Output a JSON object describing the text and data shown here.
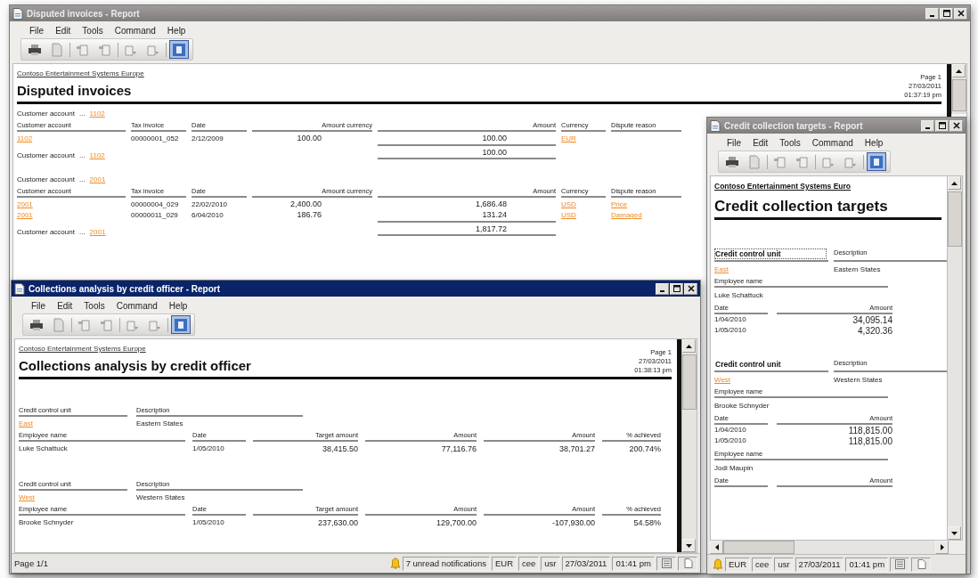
{
  "windows": [
    {
      "kind": "disputed",
      "title": "Disputed invoices - Report",
      "active": false,
      "menu": [
        "File",
        "Edit",
        "Tools",
        "Command",
        "Help"
      ],
      "toolbar": [
        {
          "kind": "print",
          "selected": false
        },
        {
          "kind": "copy",
          "selected": false
        },
        {
          "kind": "up",
          "selected": false
        },
        {
          "kind": "down",
          "selected": false
        },
        {
          "kind": "prev",
          "selected": false
        },
        {
          "kind": "next",
          "selected": false
        },
        {
          "kind": "fit",
          "selected": true
        }
      ],
      "company": "Contoso Entertainment Systems Europe",
      "heading": "Disputed invoices",
      "page": "Page 1",
      "date": "27/03/2011",
      "time": "01:37:19 pm",
      "groups": [
        {
          "label": "Customer account",
          "leader": "...",
          "account": "1102",
          "columns": [
            "Customer account",
            "Tax invoice",
            "Date",
            "Amount currency",
            "Amount",
            "Currency",
            "Dispute reason"
          ],
          "rows": [
            {
              "account": "1102",
              "tax_invoice": "00000001_052",
              "date": "2/12/2009",
              "amount_currency": "100.00",
              "amount": "100.00",
              "currency": "EUR"
            }
          ],
          "footer_label": "Customer account",
          "footer_leader": "...",
          "footer_account": "1102",
          "total": "100.00"
        },
        {
          "label": "Customer account",
          "leader": "...",
          "account": "2001",
          "columns": [
            "Customer account",
            "Tax invoice",
            "Date",
            "Amount currency",
            "Amount",
            "Currency",
            "Dispute reason"
          ],
          "rows": [
            {
              "account": "2001",
              "tax_invoice": "00000004_029",
              "date": "22/02/2010",
              "amount_currency": "2,400.00",
              "amount": "1,686.48",
              "currency": "USD",
              "dispute_reason": "Price"
            },
            {
              "account": "2001",
              "tax_invoice": "00000011_029",
              "date": "6/04/2010",
              "amount_currency": "186.76",
              "amount": "131.24",
              "currency": "USD",
              "dispute_reason": "Damaged"
            }
          ],
          "footer_label": "Customer account",
          "footer_leader": "...",
          "footer_account": "2001",
          "total": "1,817.72"
        }
      ]
    },
    {
      "kind": "collections",
      "title": "Collections analysis by credit officer - Report",
      "active": true,
      "menu": [
        "File",
        "Edit",
        "Tools",
        "Command",
        "Help"
      ],
      "toolbar": [
        {
          "kind": "print",
          "selected": false
        },
        {
          "kind": "copy",
          "selected": false
        },
        {
          "kind": "up",
          "selected": false
        },
        {
          "kind": "down",
          "selected": false
        },
        {
          "kind": "prev",
          "selected": false
        },
        {
          "kind": "next",
          "selected": false
        },
        {
          "kind": "fit",
          "selected": true
        }
      ],
      "company": "Contoso Entertainment Systems Europe",
      "heading": "Collections analysis by credit officer",
      "page": "Page 1",
      "date": "27/03/2011",
      "time": "01:38:13 pm",
      "groups": [
        {
          "unit_label": "Credit control unit",
          "description_label": "Description",
          "unit": "East",
          "description": "Eastern States",
          "columns": [
            "Employee name",
            "Date",
            "Target amount",
            "Amount",
            "Amount",
            "% achieved"
          ],
          "rows": [
            {
              "employee": "Luke Schattuck",
              "date": "1/05/2010",
              "target": "38,415.50",
              "amount": "77,116.76",
              "amount_2": "38,701.27",
              "achieved": "200.74%"
            }
          ]
        },
        {
          "unit_label": "Credit control unit",
          "description_label": "Description",
          "unit": "West",
          "description": "Western States",
          "columns": [
            "Employee name",
            "Date",
            "Target amount",
            "Amount",
            "Amount",
            "% achieved"
          ],
          "rows": [
            {
              "employee": "Brooke Schnyder",
              "date": "1/05/2010",
              "target": "237,630.00",
              "amount": "129,700.00",
              "amount_2": "-107,930.00",
              "achieved": "54.58%"
            }
          ]
        }
      ],
      "status_bar": {
        "page": "Page 1/1",
        "cells": [
          "7 unread notifications",
          "EUR",
          "cee",
          "usr",
          "27/03/2011",
          "01:41 pm"
        ]
      }
    },
    {
      "kind": "targets",
      "title": "Credit collection targets - Report",
      "active": false,
      "menu": [
        "File",
        "Edit",
        "Tools",
        "Command",
        "Help"
      ],
      "toolbar": [
        {
          "kind": "print",
          "selected": false
        },
        {
          "kind": "copy",
          "selected": false
        },
        {
          "kind": "up",
          "selected": false
        },
        {
          "kind": "down",
          "selected": false
        },
        {
          "kind": "prev",
          "selected": false
        },
        {
          "kind": "next",
          "selected": false
        },
        {
          "kind": "fit",
          "selected": true
        }
      ],
      "company": "Contoso Entertainment Systems Euro",
      "heading": "Credit collection targets",
      "groups": [
        {
          "unit_label": "Credit control unit",
          "description_label": "Description",
          "unit": "East",
          "description": "Eastern States",
          "focused": true,
          "employees": [
            {
              "label": "Employee name",
              "name": "Luke Schattuck",
              "columns": [
                "Date",
                "Amount"
              ],
              "rows": [
                {
                  "date": "1/04/2010",
                  "amount": "34,095.14"
                },
                {
                  "date": "1/05/2010",
                  "amount": "4,320.36"
                }
              ]
            }
          ]
        },
        {
          "unit_label": "Credit control unit",
          "description_label": "Description",
          "unit": "West",
          "description": "Western States",
          "focused": false,
          "employees": [
            {
              "label": "Employee name",
              "name": "Brooke Schnyder",
              "columns": [
                "Date",
                "Amount"
              ],
              "rows": [
                {
                  "date": "1/04/2010",
                  "amount": "118,815.00"
                },
                {
                  "date": "1/05/2010",
                  "amount": "118,815.00"
                }
              ]
            },
            {
              "label": "Employee name",
              "name": "Jodi Maupin",
              "columns": [
                "Date",
                "Amount"
              ]
            }
          ]
        }
      ],
      "status_bar": {
        "cells": [
          "EUR",
          "cee",
          "usr",
          "27/03/2011",
          "01:41 pm"
        ]
      }
    }
  ]
}
